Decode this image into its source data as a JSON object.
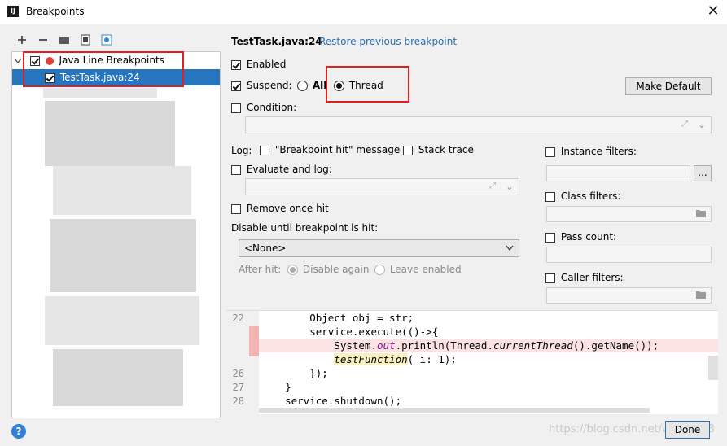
{
  "window": {
    "title": "Breakpoints",
    "app_icon": "IJ",
    "close": "✕"
  },
  "tree": {
    "group_label": "Java Line Breakpoints",
    "item_label": "TestTask.java:24",
    "accent_selected": "#2675bf",
    "breakpoint_color": "#e0413b"
  },
  "header": {
    "file": "TestTask.java:24",
    "restore_link": "Restore previous breakpoint"
  },
  "options": {
    "enabled": "Enabled",
    "suspend": "Suspend:",
    "suspend_all": "All",
    "suspend_thread": "Thread",
    "make_default": "Make Default",
    "condition": "Condition:",
    "log": "Log:",
    "log_message": "\"Breakpoint hit\" message",
    "stack_trace": "Stack trace",
    "evaluate_and_log": "Evaluate and log:",
    "remove_once_hit": "Remove once hit",
    "disable_until": "Disable until breakpoint is hit:",
    "disable_select_value": "<None>",
    "after_hit": "After hit:",
    "disable_again": "Disable again",
    "leave_enabled": "Leave enabled"
  },
  "filters": {
    "instance": "Instance filters:",
    "class": "Class filters:",
    "pass_count": "Pass count:",
    "caller": "Caller filters:",
    "more_button": "..."
  },
  "code": {
    "line_numbers": [
      "22",
      "",
      "",
      "",
      "26",
      "27",
      "28"
    ],
    "line22": "        Object obj = str;",
    "line23": "        service.execute(()->{",
    "line24_prefix": "            System.",
    "line24_out": "out",
    "line24_mid": ".println(Thread.",
    "line24_ct": "currentThread",
    "line24_suffix": "().getName());",
    "line25_indent": "            ",
    "line25_fn": "testFunction",
    "line25_suffix": "( i: 1);",
    "line26": "        });",
    "line27": "    }",
    "line28": "    service.shutdown();"
  },
  "footer": {
    "help": "?",
    "done": "Done",
    "watermark": "https://blog.csdn.net/weixin_43"
  },
  "colors": {
    "highlight_box": "#e02020",
    "link": "#2f6fb4",
    "breakpoint_line": "#fbe3e4"
  }
}
